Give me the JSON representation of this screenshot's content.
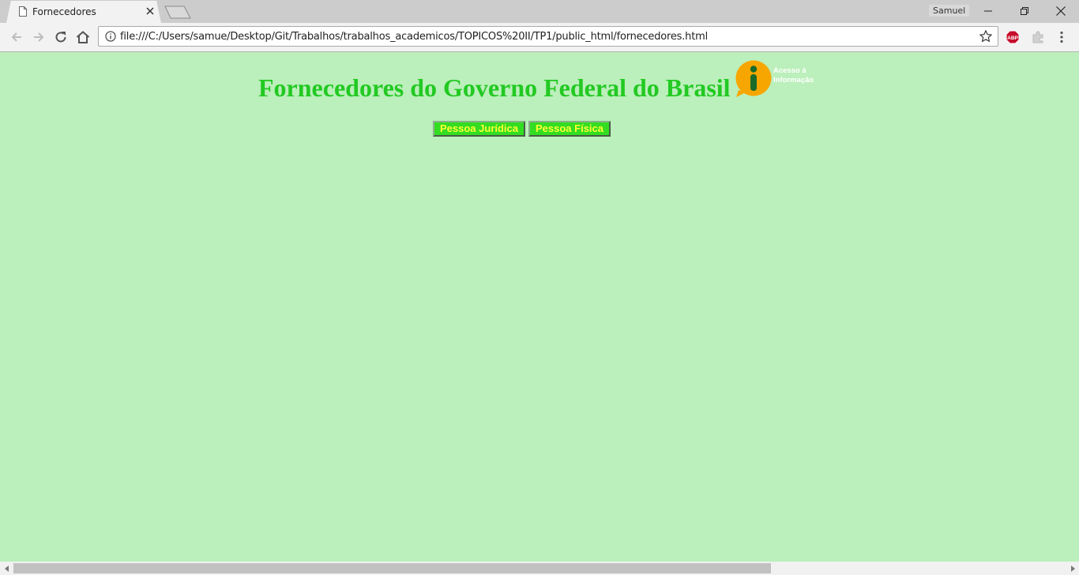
{
  "browser": {
    "tab": {
      "title": "Fornecedores",
      "favicon": "document-icon"
    },
    "profile_name": "Samuel",
    "address_bar": {
      "url": "file:///C:/Users/samue/Desktop/Git/Trabalhos/trabalhos_academicos/TOPICOS%20II/TP1/public_html/fornecedores.html"
    },
    "extensions": [
      {
        "name": "adblock-plus-icon",
        "label": "ABP"
      },
      {
        "name": "puzzle-extension-icon"
      }
    ]
  },
  "page": {
    "title": "Fornecedores do Governo Federal do Brasil",
    "logo": {
      "line1": "Acesso à",
      "line2": "Informação",
      "icon": "acesso-informacao-icon",
      "color": "#f7a600"
    },
    "buttons": [
      {
        "label": "Pessoa Jurídica"
      },
      {
        "label": "Pessoa Física"
      }
    ]
  },
  "colors": {
    "page_background": "#bbefbb",
    "title": "#22c922",
    "button_bg": "#33dd22",
    "button_text": "#ffff33"
  }
}
